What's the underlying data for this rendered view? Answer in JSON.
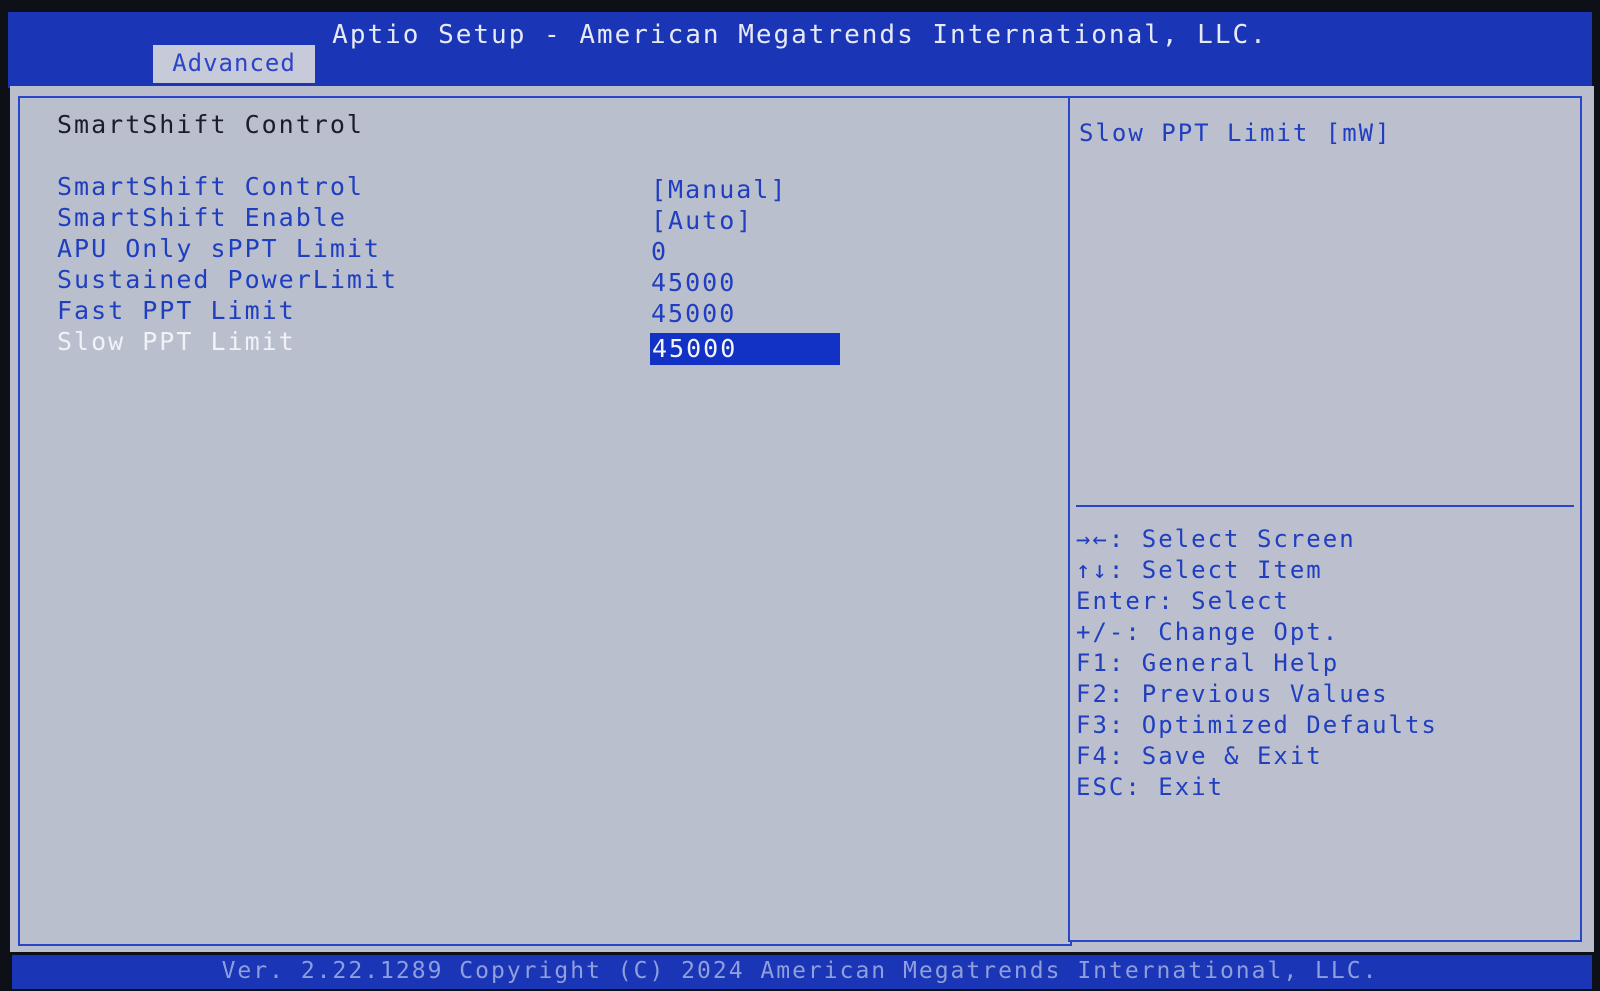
{
  "header": {
    "title": "Aptio Setup - American Megatrends International, LLC.",
    "active_tab": "Advanced"
  },
  "page": {
    "section_title": "SmartShift Control",
    "items": [
      {
        "label": "SmartShift Control",
        "value": "[Manual]"
      },
      {
        "label": "SmartShift Enable",
        "value": "[Auto]"
      },
      {
        "label": "APU Only sPPT Limit",
        "value": "0"
      },
      {
        "label": "Sustained PowerLimit",
        "value": "45000"
      },
      {
        "label": "Fast PPT Limit",
        "value": "45000"
      },
      {
        "label": "Slow PPT Limit",
        "value": "45000",
        "selected": true
      }
    ]
  },
  "help": {
    "text": "Slow PPT Limit [mW]"
  },
  "keys": [
    "→←: Select Screen",
    "↑↓: Select Item",
    "Enter: Select",
    "+/-: Change Opt.",
    "F1: General Help",
    "F2: Previous Values",
    "F3: Optimized Defaults",
    "F4: Save & Exit",
    "ESC: Exit"
  ],
  "footer": {
    "text": "Ver. 2.22.1289 Copyright (C) 2024 American Megatrends International, LLC."
  },
  "colors": {
    "frame_blue": "#1a35b6",
    "panel_gray": "#babfcd",
    "text_blue": "#1f3ec0",
    "highlight": "#1132c4"
  }
}
